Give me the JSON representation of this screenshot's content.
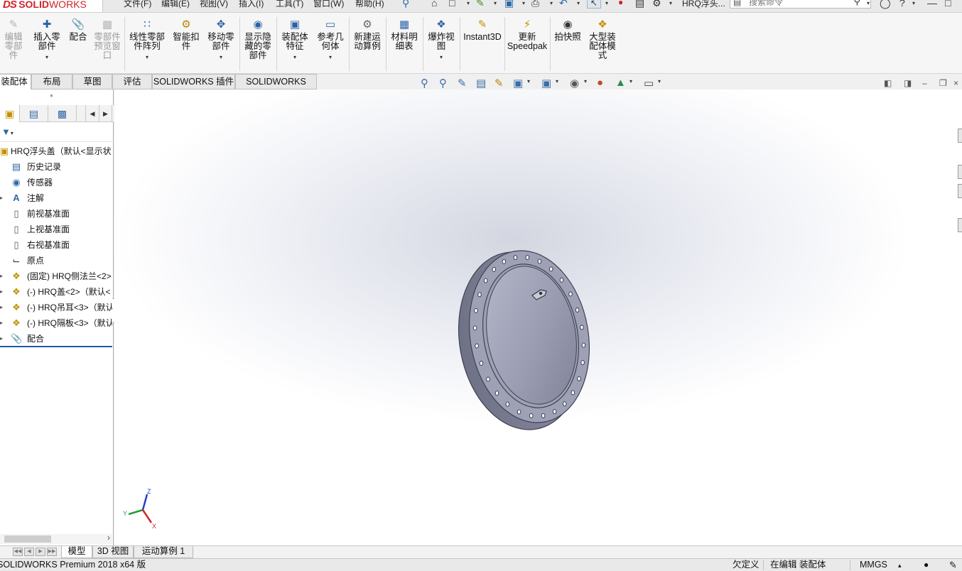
{
  "app": {
    "logo_ds": "DS",
    "logo_solid": "SOLID",
    "logo_works": "WORKS",
    "document_title": "HRQ浮头...",
    "accent_color": "#d2232a"
  },
  "menu": {
    "file": "文件(F)",
    "edit": "编辑(E)",
    "view": "视图(V)",
    "insert": "插入(I)",
    "tools": "工具(T)",
    "window": "窗口(W)",
    "help": "帮助(H)"
  },
  "search": {
    "placeholder": "搜索命令"
  },
  "command_manager": {
    "edit_component": "编辑零部件",
    "insert_components": "插入零部件",
    "mate": "配合",
    "component_preview": "零部件预览窗口",
    "linear_pattern": "线性零部件阵列",
    "smart_fasteners": "智能扣件",
    "move_component": "移动零部件",
    "show_hidden": "显示隐藏的零部件",
    "assembly_features": "装配体特征",
    "reference_geometry": "参考几何体",
    "new_motion_study": "新建运动算例",
    "bill_of_materials": "材料明细表",
    "exploded_view": "爆炸视图",
    "instant3d": "Instant3D",
    "update_speedpak_1": "更新",
    "update_speedpak_2": "Speedpak",
    "snapshot": "拍快照",
    "large_assembly_mode": "大型装配体模式"
  },
  "tabs": [
    {
      "label": "装配体"
    },
    {
      "label": "布局"
    },
    {
      "label": "草图"
    },
    {
      "label": "评估"
    },
    {
      "label": "SOLIDWORKS 插件"
    },
    {
      "label": "SOLIDWORKS MBD"
    }
  ],
  "tree": {
    "root": "HRQ浮头盖（默认<显示状",
    "history": "历史记录",
    "sensors": "传感器",
    "annotations": "注解",
    "front_plane": "前视基准面",
    "top_plane": "上视基准面",
    "right_plane": "右视基准面",
    "origin": "原点",
    "comp1": "(固定) HRQ侧法兰<2>",
    "comp2": "(-) HRQ盖<2>（默认<",
    "comp3": "(-) HRQ吊耳<3>（默认",
    "comp4": "(-) HRQ隔板<3>（默认",
    "mates": "配合"
  },
  "triad": {
    "x": "X",
    "y": "Y",
    "z": "Z"
  },
  "bottom_tabs": [
    {
      "label": "模型"
    },
    {
      "label": "3D 视图"
    },
    {
      "label": "运动算例 1"
    }
  ],
  "status": {
    "product": "SOLIDWORKS Premium 2018 x64 版",
    "under_defined": "欠定义",
    "editing": "在编辑 装配体",
    "units": "MMGS"
  }
}
